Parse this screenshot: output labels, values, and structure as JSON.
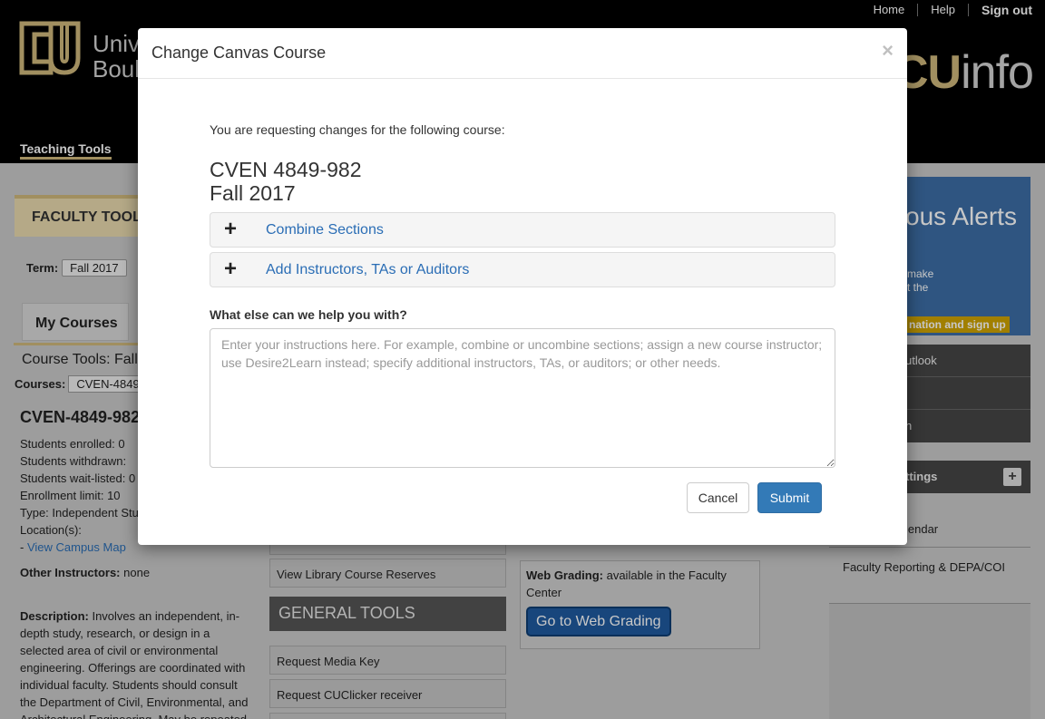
{
  "header": {
    "links": [
      "Home",
      "Help",
      "Sign out"
    ],
    "university": [
      "Univ",
      "Boul"
    ],
    "portal": {
      "cu": "CU",
      "info": "info"
    },
    "nav_tab": "Teaching Tools"
  },
  "left": {
    "faculty_tools": "FACULTY TOOL",
    "term_label": "Term:",
    "term_value": "Fall 2017",
    "my_courses": "My Courses",
    "course_tools": "Course Tools: Fall",
    "courses_label": "Courses:",
    "courses_value": "CVEN-4849",
    "course_id": "CVEN-4849-982",
    "stats": [
      "Students enrolled: 0",
      "Students withdrawn:",
      "Students wait-listed: 0",
      "Enrollment limit: 10",
      "Type: Independent Stu",
      "Location(s):"
    ],
    "map_prefix": "- ",
    "map_link": "View Campus Map",
    "other_label": "Other Instructors:",
    "other_value": " none",
    "desc_label": "Description:",
    "desc_text": " Involves an independent, in-depth study, research, or design in a selected area of civil or environmental engineering. Offerings are coordinated with individual faculty. Students should consult the Department of Civil, Environmental, and Architectural Engineering. May be repeated"
  },
  "middle": {
    "library": "View Library Course Reserves",
    "general_tools": "GENERAL TOOLS",
    "media_key": "Request Media Key",
    "cuclicker": "Request CUClicker receiver"
  },
  "web_grading": {
    "label": "Web Grading:",
    "text": " available in the Faculty Center",
    "button": "Go to Web Grading"
  },
  "right": {
    "alerts_title": "ous Alerts",
    "alerts_line1": "make",
    "alerts_line2": "t the",
    "alerts_signup": "nation and sign up",
    "panel_items": [
      "utlook",
      "",
      "n"
    ],
    "settings": "ttings",
    "calendar": "lendar",
    "faculty_reporting": "Faculty Reporting & DEPA/COI"
  },
  "modal": {
    "title": "Change Canvas Course",
    "close": "×",
    "intro": "You are requesting changes for the following course:",
    "course_code": "CVEN 4849-982",
    "course_term": "Fall 2017",
    "sections": [
      {
        "plus": "+",
        "label": "Combine Sections"
      },
      {
        "plus": "+",
        "label": "Add Instructors, TAs or Auditors"
      }
    ],
    "help_label": "What else can we help you with?",
    "help_placeholder": "Enter your instructions here. For example, combine or uncombine sections; assign a new course instructor; use Desire2Learn instead; specify additional instructors, TAs, or auditors; or other needs.",
    "cancel": "Cancel",
    "submit": "Submit"
  },
  "colors": {
    "cu_gold": "#cfb87c",
    "link_blue": "#2a6db5",
    "primary_button": "#337ab7"
  }
}
